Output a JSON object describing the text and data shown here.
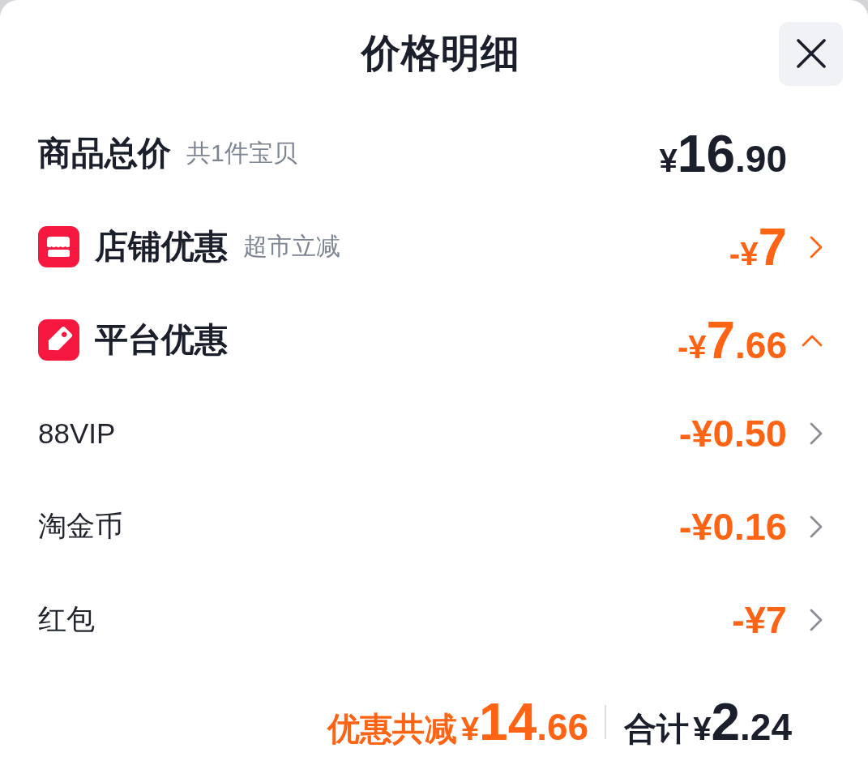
{
  "title": "价格明细",
  "rows": [
    {
      "kind": "total",
      "label": "商品总价",
      "note": "共1件宝贝",
      "amount": {
        "symbol": "¥",
        "integer": "16",
        "decimal": ".90"
      }
    },
    {
      "kind": "shop",
      "label": "店铺优惠",
      "note": "超市立减",
      "amount": {
        "symbol": "-¥",
        "integer": "7"
      },
      "expanded": false
    },
    {
      "kind": "platform",
      "label": "平台优惠",
      "amount": {
        "symbol": "-¥",
        "integer": "7",
        "decimal": ".66"
      },
      "expanded": true,
      "children": [
        {
          "label": "88VIP",
          "amount": "-¥0.50"
        },
        {
          "label": "淘金币",
          "amount": "-¥0.16"
        },
        {
          "label": "红包",
          "amount": "-¥7"
        }
      ]
    }
  ],
  "footer": {
    "discount_label": "优惠共减",
    "discount_amount": {
      "symbol": "¥",
      "integer": "14",
      "decimal": ".66"
    },
    "total_label": "合计",
    "total_amount": {
      "symbol": "¥",
      "integer": "2",
      "decimal": ".24"
    }
  }
}
